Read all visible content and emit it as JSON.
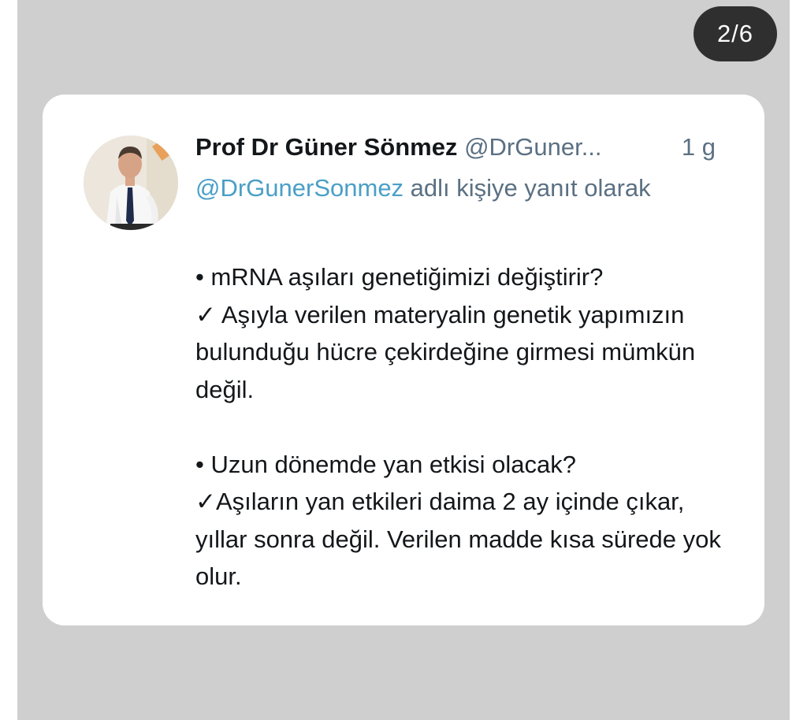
{
  "story": {
    "page_counter": "2/6"
  },
  "tweet": {
    "author_name": "Prof Dr Güner Sönmez",
    "author_handle": "@DrGuner...",
    "time_ago": "1 g",
    "reply_mention": "@DrGunerSonmez",
    "reply_suffix": " adlı kişiye yanıt olarak",
    "paragraph_1": "• mRNA aşıları genetiğimizi değiştirir?\n✓ Aşıyla verilen materyalin genetik yapımızın bulunduğu hücre çekirdeğine girmesi mümkün değil.",
    "paragraph_2": "• Uzun dönemde yan etkisi olacak?\n✓Aşıların yan etkileri daima 2 ay içinde çıkar, yıllar sonra değil. Verilen madde kısa sürede yok olur."
  },
  "colors": {
    "background_panel": "#cfcfcf",
    "card": "#ffffff",
    "counter_bg": "#2f2f2f",
    "handle_gray": "#5b7083",
    "mention_blue": "#4a9fc7",
    "text": "#14171a"
  }
}
